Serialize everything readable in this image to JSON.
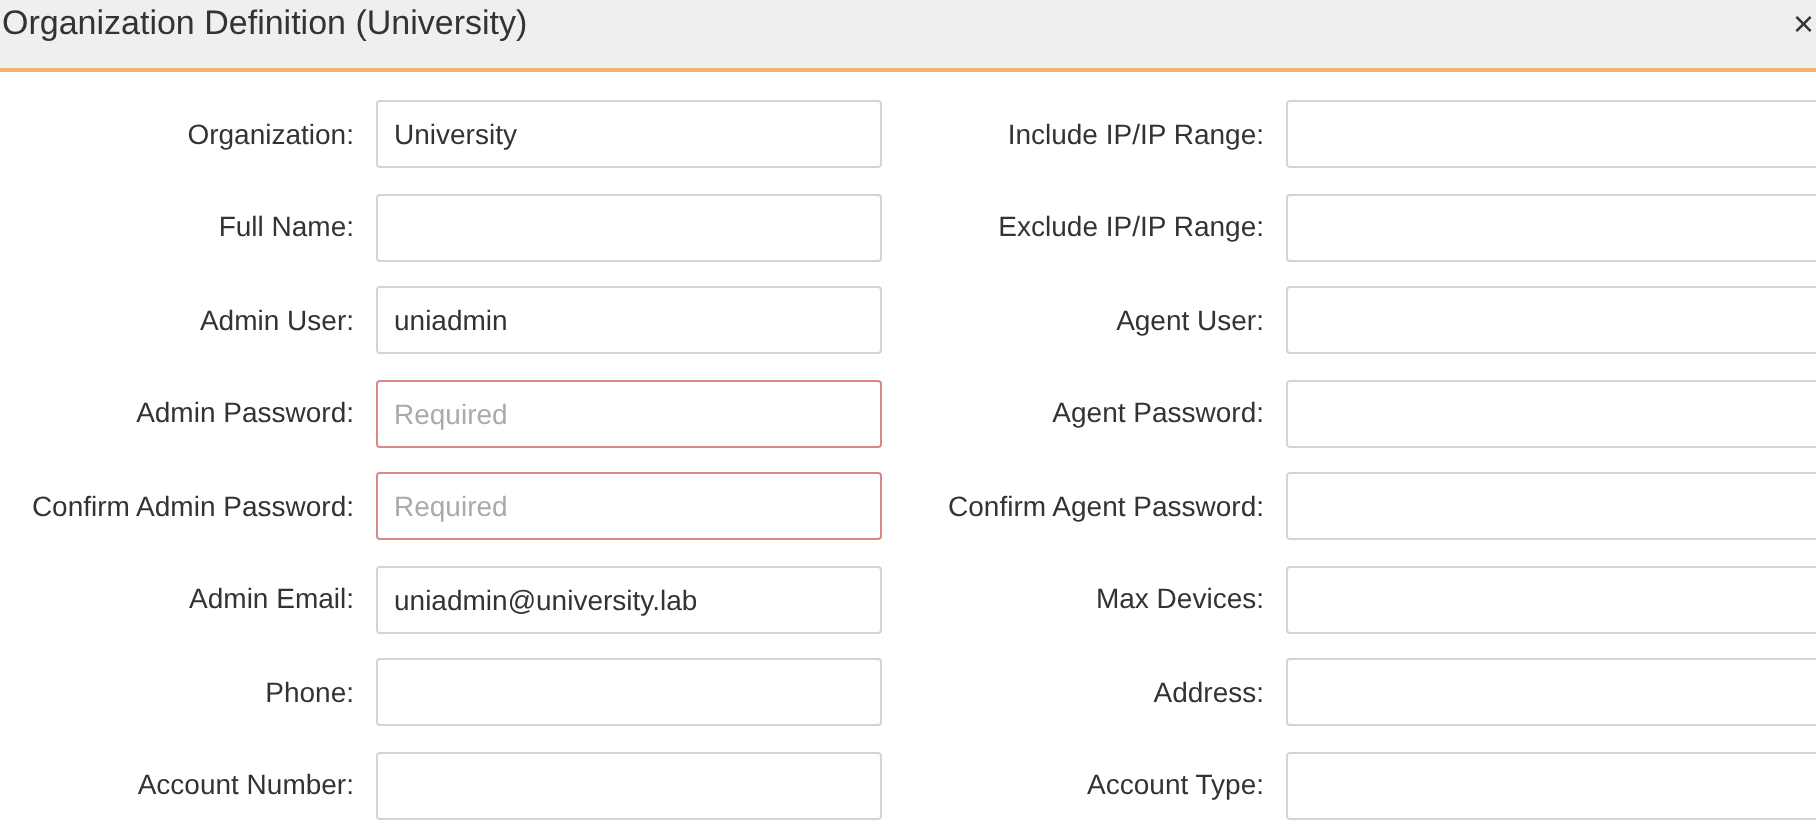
{
  "dialog": {
    "title": "Organization Definition (University)",
    "close": "×"
  },
  "left_fields": [
    {
      "label": "Organization:",
      "value": "University",
      "invalid": false
    },
    {
      "label": "Full Name:",
      "invalid": false
    },
    {
      "label": "Admin User:",
      "value": "uniadmin",
      "invalid": false
    },
    {
      "label": "Admin Password:",
      "placeholder": "Required",
      "invalid": true
    },
    {
      "label": "Confirm Admin Password:",
      "placeholder": "Required",
      "invalid": true
    },
    {
      "label": "Admin Email:",
      "value": "uniadmin@university.lab",
      "invalid": false
    },
    {
      "label": "Phone:",
      "invalid": false
    },
    {
      "label": "Account Number:",
      "invalid": false
    }
  ],
  "right_fields": [
    {
      "label": "Include IP/IP Range:",
      "invalid": false
    },
    {
      "label": "Exclude IP/IP Range:",
      "invalid": false
    },
    {
      "label": "Agent User:",
      "invalid": false
    },
    {
      "label": "Agent Password:",
      "invalid": false
    },
    {
      "label": "Confirm Agent Password:",
      "invalid": false
    },
    {
      "label": "Max Devices:",
      "invalid": false
    },
    {
      "label": "Address:",
      "invalid": false
    },
    {
      "label": "Account Type:",
      "invalid": false
    }
  ]
}
